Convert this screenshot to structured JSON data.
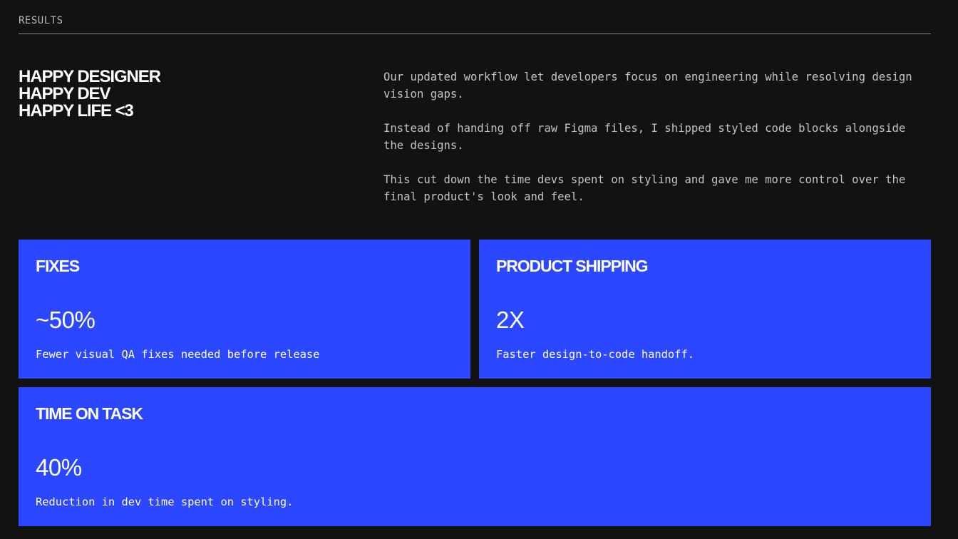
{
  "section": {
    "label": "RESULTS"
  },
  "headline": {
    "lines": [
      "HAPPY DESIGNER",
      "HAPPY DEV",
      "HAPPY LIFE <3"
    ]
  },
  "description": {
    "paragraphs": [
      "Our updated workflow let developers focus on engineering while resolving design vision gaps.",
      "Instead of handing off raw Figma files, I shipped styled code blocks alongside the designs.",
      "This cut down the time devs spent on styling and gave me more control over the final product's look and feel."
    ]
  },
  "cards": [
    {
      "title": "FIXES",
      "metric": "~50%",
      "caption": "Fewer visual QA fixes needed before release"
    },
    {
      "title": "PRODUCT SHIPPING",
      "metric": "2X",
      "caption": "Faster design-to-code handoff."
    },
    {
      "title": "TIME ON TASK",
      "metric": "40%",
      "caption": "Reduction in dev time spent on styling."
    }
  ],
  "colors": {
    "background": "#121212",
    "card": "#2b47ff",
    "text": "#ffffff",
    "muted_text": "#c4c4c4"
  }
}
